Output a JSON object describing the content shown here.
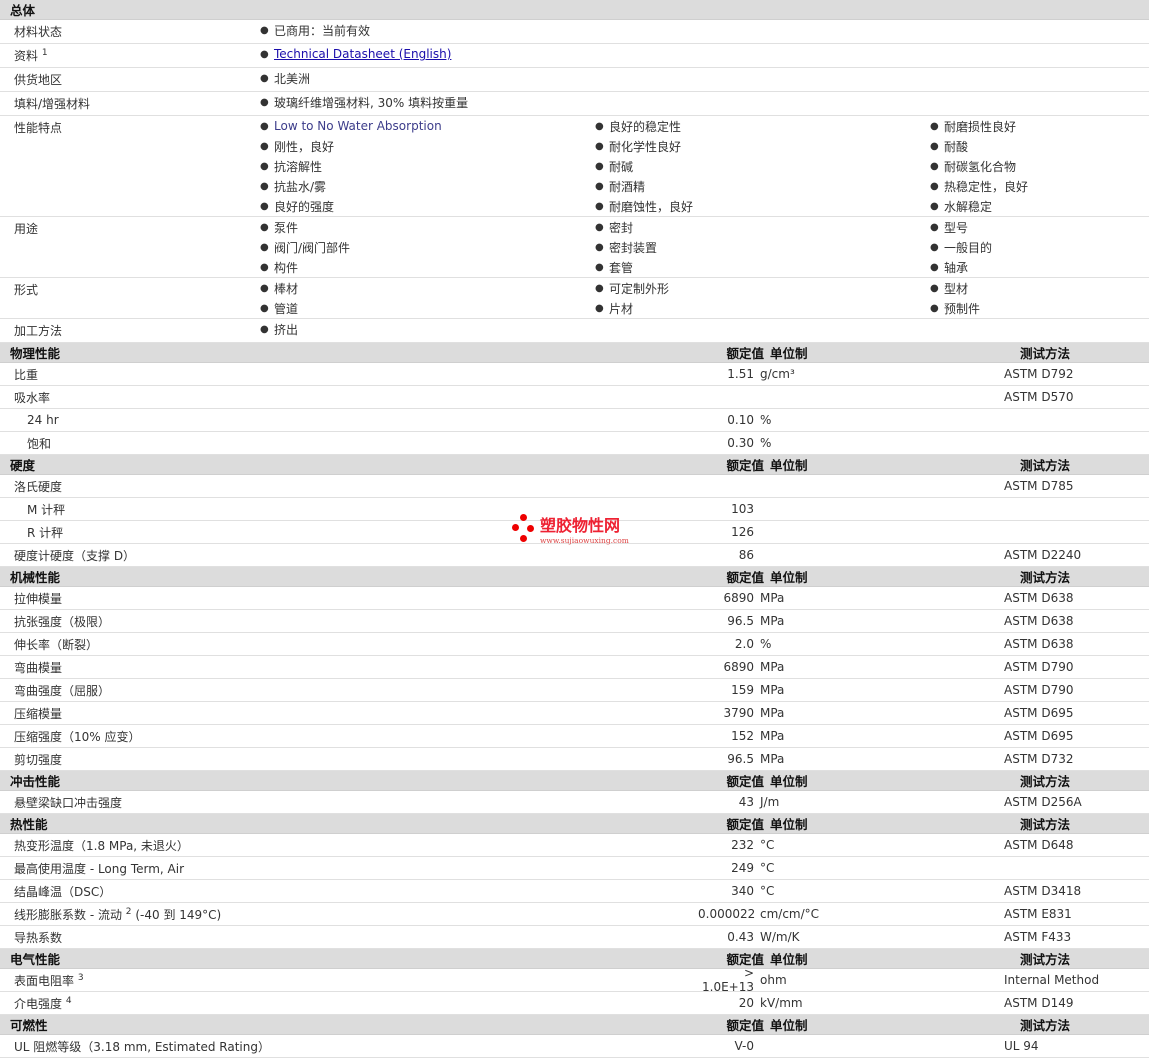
{
  "general": {
    "title": "总体",
    "rows": [
      {
        "label": "材料状态",
        "cols": [
          [
            "已商用：当前有效"
          ]
        ]
      },
      {
        "label": "资料",
        "sup": "1",
        "cols": [
          [
            "Technical Datasheet (English)"
          ]
        ]
      },
      {
        "label": "供货地区",
        "cols": [
          [
            "北美洲"
          ]
        ]
      },
      {
        "label": "填料/增强材料",
        "cols": [
          [
            "玻璃纤维增强材料, 30% 填料按重量"
          ]
        ]
      },
      {
        "label": "性能特点",
        "cols": [
          [
            "Low to No Water Absorption",
            "刚性，良好",
            "抗溶解性",
            "抗盐水/雾",
            "良好的强度"
          ],
          [
            "良好的稳定性",
            "耐化学性良好",
            "耐碱",
            "耐酒精",
            "耐磨蚀性，良好"
          ],
          [
            "耐磨损性良好",
            "耐酸",
            "耐碳氢化合物",
            "热稳定性，良好",
            "水解稳定"
          ]
        ]
      },
      {
        "label": "用途",
        "cols": [
          [
            "泵件",
            "阀门/阀门部件",
            "构件"
          ],
          [
            "密封",
            "密封装置",
            "套管"
          ],
          [
            "型号",
            "一般目的",
            "轴承"
          ]
        ]
      },
      {
        "label": "形式",
        "cols": [
          [
            "棒材",
            "管道"
          ],
          [
            "可定制外形",
            "片材"
          ],
          [
            "型材",
            "预制件"
          ]
        ]
      },
      {
        "label": "加工方法",
        "cols": [
          [
            "挤出"
          ]
        ]
      }
    ]
  },
  "headers": {
    "value": "额定值",
    "unit": "单位制",
    "method": "测试方法"
  },
  "sections": [
    {
      "title": "物理性能",
      "rows": [
        {
          "label": "比重",
          "value": "1.51",
          "unit": "g/cm³",
          "method": "ASTM D792"
        },
        {
          "label": "吸水率",
          "value": "",
          "unit": "",
          "method": "ASTM D570"
        },
        {
          "label": "24 hr",
          "sub": true,
          "value": "0.10",
          "unit": "%",
          "method": ""
        },
        {
          "label": "饱和",
          "sub": true,
          "value": "0.30",
          "unit": "%",
          "method": ""
        }
      ]
    },
    {
      "title": "硬度",
      "rows": [
        {
          "label": "洛氏硬度",
          "value": "",
          "unit": "",
          "method": "ASTM D785"
        },
        {
          "label": "M 计秤",
          "sub": true,
          "value": "103",
          "unit": "",
          "method": ""
        },
        {
          "label": "R 计秤",
          "sub": true,
          "value": "126",
          "unit": "",
          "method": ""
        },
        {
          "label": "硬度计硬度（支撑 D）",
          "value": "86",
          "unit": "",
          "method": "ASTM D2240"
        }
      ]
    },
    {
      "title": "机械性能",
      "rows": [
        {
          "label": "拉伸模量",
          "value": "6890",
          "unit": "MPa",
          "method": "ASTM D638"
        },
        {
          "label": "抗张强度（极限）",
          "value": "96.5",
          "unit": "MPa",
          "method": "ASTM D638"
        },
        {
          "label": "伸长率（断裂）",
          "value": "2.0",
          "unit": "%",
          "method": "ASTM D638"
        },
        {
          "label": "弯曲模量",
          "value": "6890",
          "unit": "MPa",
          "method": "ASTM D790"
        },
        {
          "label": "弯曲强度（屈服）",
          "value": "159",
          "unit": "MPa",
          "method": "ASTM D790"
        },
        {
          "label": "压缩模量",
          "value": "3790",
          "unit": "MPa",
          "method": "ASTM D695"
        },
        {
          "label": "压缩强度（10% 应变）",
          "value": "152",
          "unit": "MPa",
          "method": "ASTM D695"
        },
        {
          "label": "剪切强度",
          "value": "96.5",
          "unit": "MPa",
          "method": "ASTM D732"
        }
      ]
    },
    {
      "title": "冲击性能",
      "rows": [
        {
          "label": "悬壁梁缺口冲击强度",
          "value": "43",
          "unit": "J/m",
          "method": "ASTM D256A"
        }
      ]
    },
    {
      "title": "热性能",
      "rows": [
        {
          "label": "热变形温度（1.8 MPa, 未退火）",
          "value": "232",
          "unit": "°C",
          "method": "ASTM D648"
        },
        {
          "label": "最高使用温度 - Long Term, Air",
          "value": "249",
          "unit": "°C",
          "method": ""
        },
        {
          "label": "结晶峰温（DSC）",
          "value": "340",
          "unit": "°C",
          "method": "ASTM D3418"
        },
        {
          "label": "线形膨胀系数 - 流动",
          "sup": "2",
          "suffix": " (-40 到  149°C)",
          "value": "0.000022",
          "unit": "cm/cm/°C",
          "method": "ASTM E831"
        },
        {
          "label": "导热系数",
          "value": "0.43",
          "unit": "W/m/K",
          "method": "ASTM F433"
        }
      ]
    },
    {
      "title": "电气性能",
      "rows": [
        {
          "label": "表面电阻率",
          "sup": "3",
          "value": "> 1.0E+13",
          "unit": "ohm",
          "method": "Internal Method"
        },
        {
          "label": "介电强度",
          "sup": "4",
          "value": "20",
          "unit": "kV/mm",
          "method": "ASTM D149"
        }
      ]
    },
    {
      "title": "可燃性",
      "rows": [
        {
          "label": "UL 阻燃等级（3.18 mm, Estimated Rating）",
          "value": "V-0",
          "unit": "",
          "method": "UL 94"
        }
      ]
    }
  ],
  "watermark": {
    "cn": "塑胶物性网",
    "en": "www.sujiaowuxing.com",
    "color": "#e00000"
  }
}
